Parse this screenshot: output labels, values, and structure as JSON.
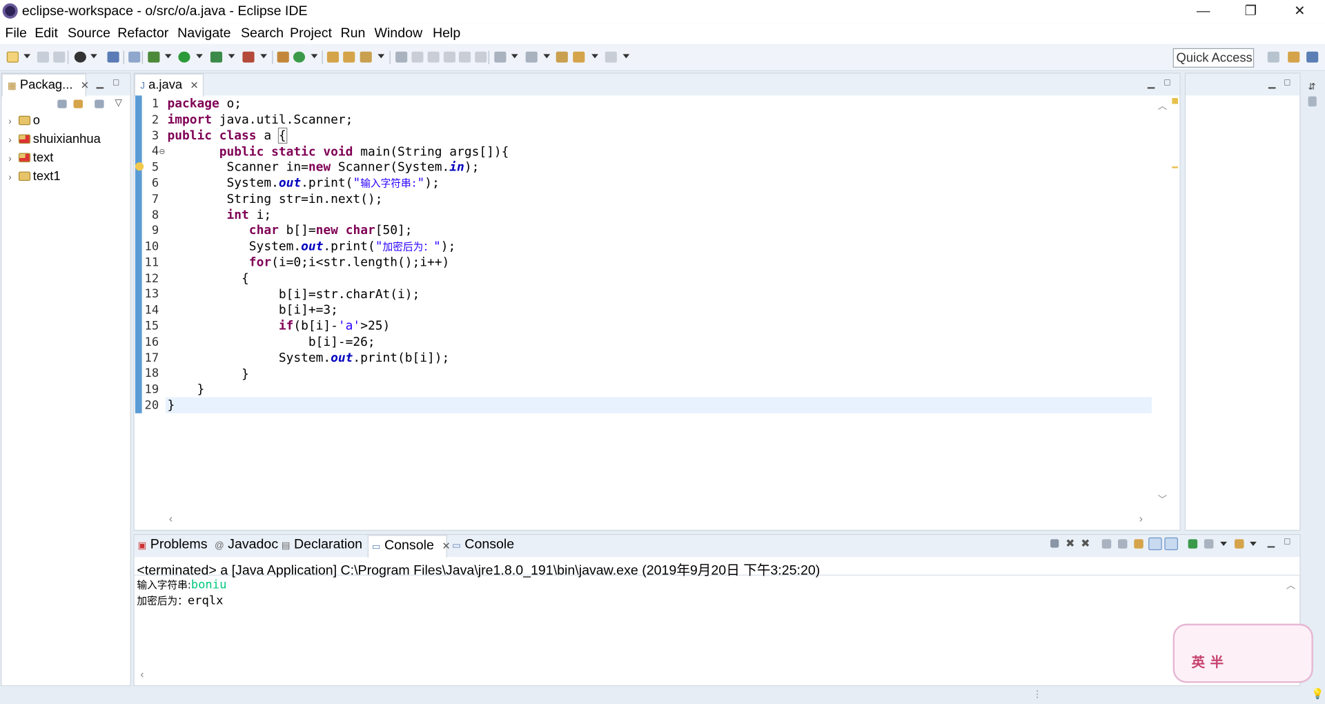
{
  "window": {
    "title": "eclipse-workspace - o/src/o/a.java - Eclipse IDE",
    "minimize": "—",
    "restore": "❐",
    "close": "✕"
  },
  "menu": [
    "File",
    "Edit",
    "Source",
    "Refactor",
    "Navigate",
    "Search",
    "Project",
    "Run",
    "Window",
    "Help"
  ],
  "quick_access": "Quick Access",
  "package_explorer": {
    "tab_label": "Packag...",
    "projects": [
      {
        "name": "o",
        "has_error": false
      },
      {
        "name": "shuixianhua",
        "has_error": true
      },
      {
        "name": "text",
        "has_error": true
      },
      {
        "name": "text1",
        "has_error": false
      }
    ]
  },
  "editor": {
    "tab_label": "a.java",
    "lines": [
      "1",
      "2",
      "3",
      "4",
      "5",
      "6",
      "7",
      "8",
      "9",
      "10",
      "11",
      "12",
      "13",
      "14",
      "15",
      "16",
      "17",
      "18",
      "19",
      "20"
    ],
    "code": {
      "l1_kw": "package",
      "l1_rest": " o;",
      "l2_kw": "import",
      "l2_rest": " java.util.Scanner;",
      "l3_kw": "public class",
      "l3_rest": " a ",
      "l3_brace": "{",
      "l4_indent": "       ",
      "l4_kw": "public static void",
      "l4_rest": " main(String args[]){",
      "l5_a": "        Scanner in=",
      "l5_kw": "new",
      "l5_b": " Scanner(System.",
      "l5_fld": "in",
      "l5_c": ");",
      "l6_a": "        System.",
      "l6_fld": "out",
      "l6_b": ".print(",
      "l6_q1": "\"",
      "l6_str": "输入字符串:",
      "l6_q2": "\"",
      "l6_c": ");",
      "l7": "        String str=in.next();",
      "l8_indent": "        ",
      "l8_kw": "int",
      "l8_rest": " i;",
      "l9_indent": "           ",
      "l9_kw": "char",
      "l9_a": " b[]=",
      "l9_kw2": "new",
      "l9_kw3": " char",
      "l9_b": "[50];",
      "l10_a": "           System.",
      "l10_fld": "out",
      "l10_b": ".print(",
      "l10_q1": "\"",
      "l10_str": "加密后为：",
      "l10_q2": "\"",
      "l10_c": ");",
      "l11_indent": "           ",
      "l11_kw": "for",
      "l11_rest": "(i=0;i<str.length();i++)",
      "l12": "          {",
      "l13": "               b[i]=str.charAt(i);",
      "l14": "               b[i]+=3;",
      "l15_indent": "               ",
      "l15_kw": "if",
      "l15_a": "(b[i]-",
      "l15_str": "'a'",
      "l15_b": ">25)",
      "l16": "                   b[i]-=26;",
      "l17_a": "               System.",
      "l17_fld": "out",
      "l17_b": ".print(b[i]);",
      "l18": "          }",
      "l19": "    }",
      "l20": "}"
    }
  },
  "bottom_tabs": {
    "problems": "Problems",
    "javadoc": "Javadoc",
    "declaration": "Declaration",
    "console_active": "Console",
    "console2": "Console"
  },
  "console": {
    "header": "<terminated> a [Java Application] C:\\Program Files\\Java\\jre1.8.0_191\\bin\\javaw.exe (2019年9月20日 下午3:25:20)",
    "prompt": "输入字符串:",
    "input": "boniu",
    "result_label": "加密后为：",
    "result": "erqlx"
  },
  "watermark": {
    "text": "英半"
  }
}
